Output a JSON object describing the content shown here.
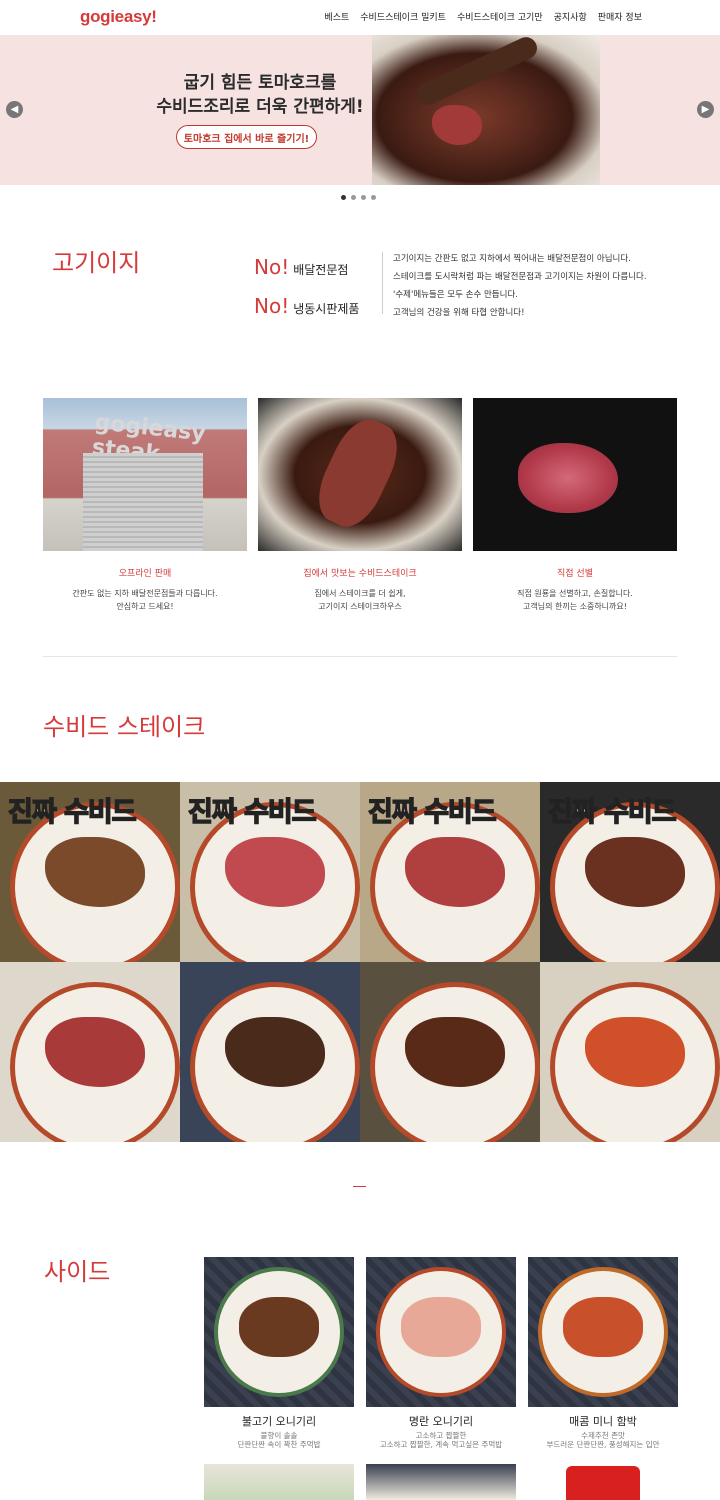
{
  "header": {
    "logo": "gogieasy!",
    "nav": [
      "베스트",
      "수비드스테이크 밀키트",
      "수비드스테이크 고기만",
      "공지사항",
      "판매자 정보"
    ]
  },
  "hero": {
    "headline_1": "굽기 힘든 토마호크를",
    "headline_2": "수비드조리로 더욱 간편하게!",
    "pill": "토마호크 집에서 바로 즐기기!",
    "prev_icon": "chevron-left-icon",
    "next_icon": "chevron-right-icon",
    "slides": 4,
    "active_slide": 1
  },
  "about": {
    "title": "고기이지",
    "no1_word": "No!",
    "no1_text": "배달전문점",
    "no2_word": "No!",
    "no2_text": "냉동시판제품",
    "lines": [
      "고기이지는 간판도 없고 지하에서 찍어내는 배달전문점이 아닙니다.",
      "스테이크를 도시락처럼 파는 배달전문점과 고기이지는 차원이 다릅니다.",
      "'수제'메뉴들은 모두 손수 만듭니다.",
      "고객님의 건강을 위해 타협 안합니다!"
    ]
  },
  "features": [
    {
      "title": "오프라인 판매",
      "desc1": "간판도 없는 지하 배달전문점들과 다릅니다.",
      "desc2": "안심하고 드세요!",
      "sign": "gogieasy steak"
    },
    {
      "title": "집에서 맛보는 수비드스테이크",
      "desc1": "집에서 스테이크를 더 쉽게,",
      "desc2": "고기이지 스테이크하우스"
    },
    {
      "title": "직접 선별",
      "desc1": "직접 원룡을 선별하고, 손질합니다.",
      "desc2": "고객님의 한끼는 소중하니까요!"
    }
  ],
  "sousvide": {
    "title": "수비드 스테이크",
    "tile_label": "진짜 수비드"
  },
  "side": {
    "title": "사이드",
    "items": [
      {
        "name": "불고기 오니기리",
        "desc1": "불향이 솔솔",
        "desc2": "단짠단짠 속이 꽉찬 주먹밥"
      },
      {
        "name": "명란 오니기리",
        "desc1": "고소하고 짭짤한",
        "desc2": "고소하고 짭짤한, 계속 먹고싶은 주먹밥"
      },
      {
        "name": "매콤 미니 함박",
        "desc1": "수제추천 존맛",
        "desc2": "부드러운 단짠단짠, 풍성해지는 입안"
      }
    ]
  },
  "colors": {
    "brand": "#d63a3a",
    "hero_bg": "#f6e3e1"
  }
}
